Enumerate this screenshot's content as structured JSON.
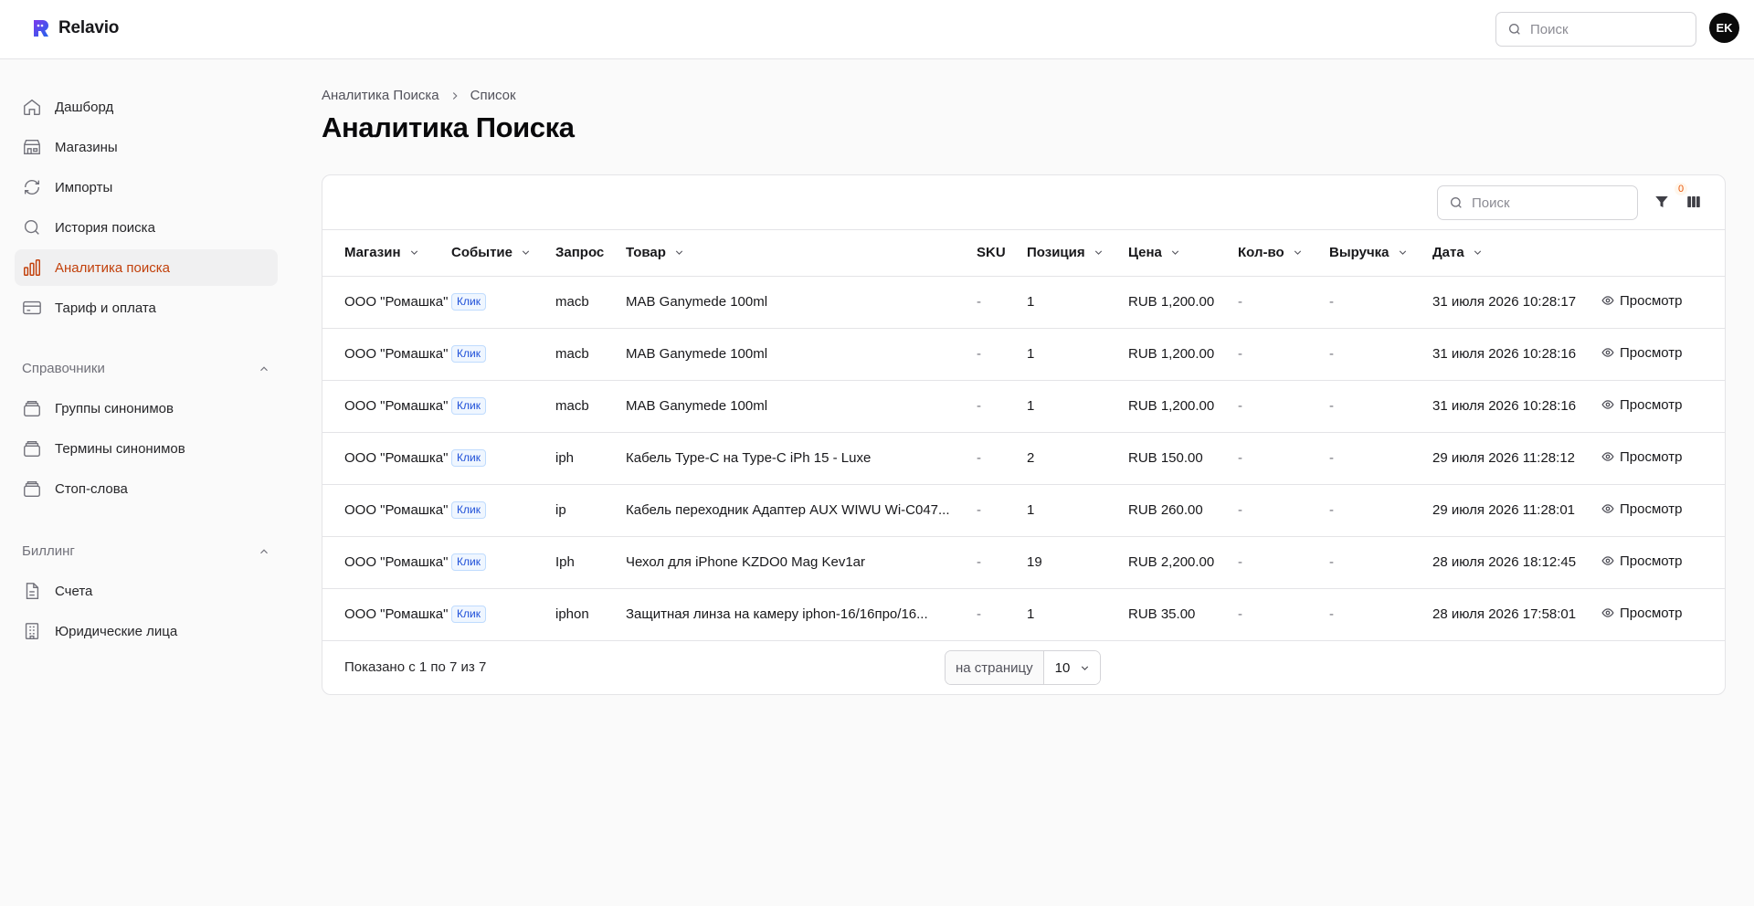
{
  "app": {
    "name": "Relavio",
    "user_initials": "EK"
  },
  "top_search": {
    "placeholder": "Поиск"
  },
  "sidebar": {
    "items": [
      {
        "label": "Дашборд",
        "icon": "home-icon"
      },
      {
        "label": "Магазины",
        "icon": "store-icon"
      },
      {
        "label": "Импорты",
        "icon": "refresh-icon"
      },
      {
        "label": "История поиска",
        "icon": "search-icon"
      },
      {
        "label": "Аналитика поиска",
        "icon": "bar-chart-icon",
        "active": true
      },
      {
        "label": "Тариф и оплата",
        "icon": "credit-card-icon"
      }
    ],
    "sections": [
      {
        "title": "Справочники",
        "items": [
          {
            "label": "Группы синонимов",
            "icon": "stack-icon"
          },
          {
            "label": "Термины синонимов",
            "icon": "stack-icon"
          },
          {
            "label": "Стоп-слова",
            "icon": "stack-icon"
          }
        ]
      },
      {
        "title": "Биллинг",
        "items": [
          {
            "label": "Счета",
            "icon": "document-icon"
          },
          {
            "label": "Юридические лица",
            "icon": "building-icon"
          }
        ]
      }
    ]
  },
  "breadcrumb": {
    "parent": "Аналитика Поиска",
    "current": "Список"
  },
  "page": {
    "title": "Аналитика Поиска"
  },
  "table_toolbar": {
    "search_placeholder": "Поиск",
    "filter_count": "0"
  },
  "table": {
    "columns": [
      "Магазин",
      "Событие",
      "Запрос",
      "Товар",
      "SKU",
      "Позиция",
      "Цена",
      "Кол-во",
      "Выручка",
      "Дата"
    ],
    "view_label": "Просмотр",
    "rows": [
      {
        "store": "ООО \"Ромашка\"",
        "event": "Клик",
        "query": "macb",
        "product": "MAB Ganymede 100ml",
        "sku": "-",
        "position": "1",
        "price": "RUB 1,200.00",
        "qty": "-",
        "revenue": "-",
        "date": "31 июля 2026 10:28:17"
      },
      {
        "store": "ООО \"Ромашка\"",
        "event": "Клик",
        "query": "macb",
        "product": "MAB Ganymede 100ml",
        "sku": "-",
        "position": "1",
        "price": "RUB 1,200.00",
        "qty": "-",
        "revenue": "-",
        "date": "31 июля 2026 10:28:16"
      },
      {
        "store": "ООО \"Ромашка\"",
        "event": "Клик",
        "query": "macb",
        "product": "MAB Ganymede 100ml",
        "sku": "-",
        "position": "1",
        "price": "RUB 1,200.00",
        "qty": "-",
        "revenue": "-",
        "date": "31 июля 2026 10:28:16"
      },
      {
        "store": "ООО \"Ромашка\"",
        "event": "Клик",
        "query": "iph",
        "product": "Кабель Type-C на Type-C iPh 15 - Luxe",
        "sku": "-",
        "position": "2",
        "price": "RUB 150.00",
        "qty": "-",
        "revenue": "-",
        "date": "29 июля 2026 11:28:12"
      },
      {
        "store": "ООО \"Ромашка\"",
        "event": "Клик",
        "query": "ip",
        "product": "Кабель переходник Адаптер AUX WIWU Wi-C047...",
        "sku": "-",
        "position": "1",
        "price": "RUB 260.00",
        "qty": "-",
        "revenue": "-",
        "date": "29 июля 2026 11:28:01"
      },
      {
        "store": "ООО \"Ромашка\"",
        "event": "Клик",
        "query": "Iph",
        "product": "Чехол для iPhone KZDO0 Mag Kev1ar",
        "sku": "-",
        "position": "19",
        "price": "RUB 2,200.00",
        "qty": "-",
        "revenue": "-",
        "date": "28 июля 2026 18:12:45"
      },
      {
        "store": "ООО \"Ромашка\"",
        "event": "Клик",
        "query": "iphon",
        "product": "Защитная линза на камеру iphon-16/16про/16...",
        "sku": "-",
        "position": "1",
        "price": "RUB 35.00",
        "qty": "-",
        "revenue": "-",
        "date": "28 июля 2026 17:58:01"
      }
    ]
  },
  "footer": {
    "showing": "Показано с 1 по 7 из 7",
    "per_page_label": "на страницу",
    "per_page_value": "10"
  }
}
